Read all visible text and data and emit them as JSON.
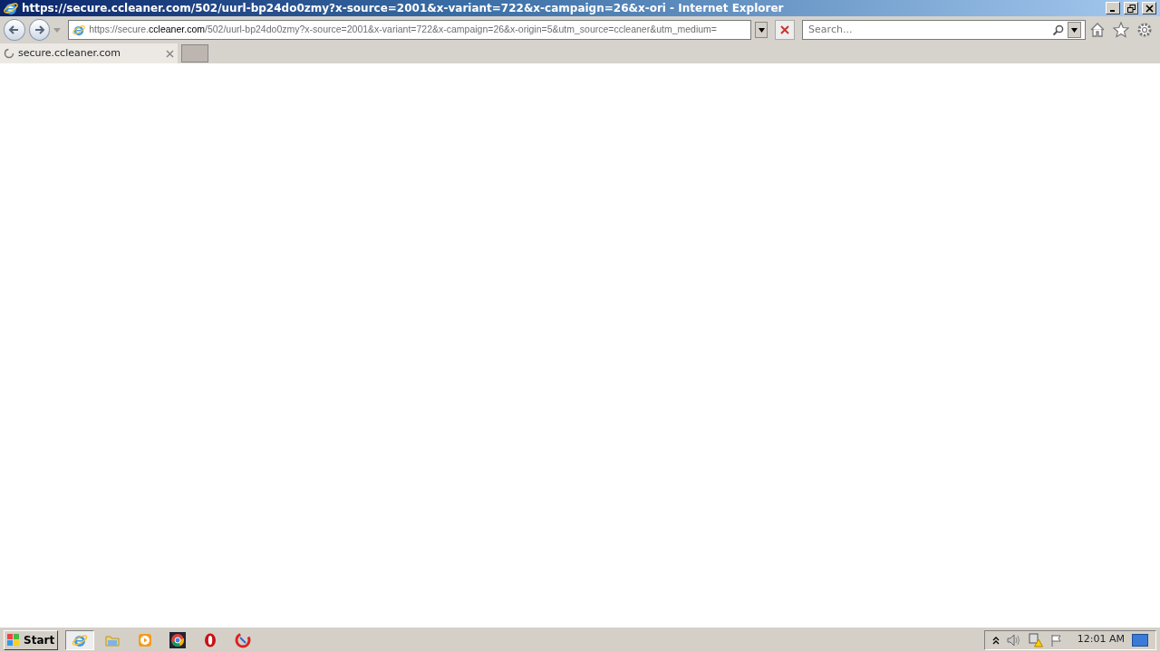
{
  "window": {
    "title": "https://secure.ccleaner.com/502/uurl-bp24do0zmy?x-source=2001&x-variant=722&x-campaign=26&x-ori - Internet Explorer"
  },
  "address_bar": {
    "prefix": "https://secure.",
    "domain": "ccleaner.com",
    "rest": "/502/uurl-bp24do0zmy?x-source=2001&x-variant=722&x-campaign=26&x-origin=5&utm_source=ccleaner&utm_medium="
  },
  "search": {
    "placeholder": "Search..."
  },
  "tabs": [
    {
      "label": "secure.ccleaner.com",
      "selected": true,
      "loading": true
    }
  ],
  "taskbar": {
    "start": "Start",
    "apps": [
      {
        "kind": "ie",
        "selected": true
      },
      {
        "kind": "folder",
        "selected": false
      },
      {
        "kind": "media",
        "selected": false
      },
      {
        "kind": "chrome",
        "selected": false
      },
      {
        "kind": "opera",
        "selected": false
      },
      {
        "kind": "ccleaner",
        "selected": false
      }
    ],
    "clock": "12:01 AM"
  }
}
